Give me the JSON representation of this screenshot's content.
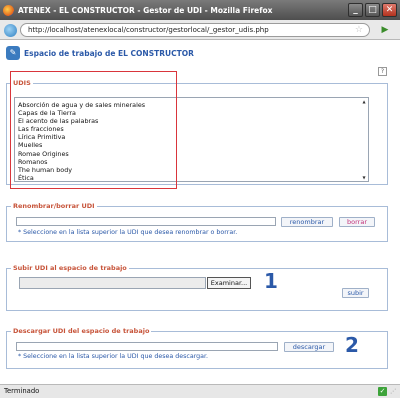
{
  "window": {
    "title": "ATENEX - EL CONSTRUCTOR - Gestor de UDI - Mozilla Firefox",
    "minimize": "_",
    "maximize": "□",
    "close": "✕"
  },
  "browser": {
    "url": "http://localhost/atenexlocal/constructor/gestorlocal/_gestor_udis.php",
    "status": "Terminado"
  },
  "page": {
    "title": "Espacio de trabajo de EL CONSTRUCTOR",
    "help": "?"
  },
  "udis": {
    "legend": "UDIS",
    "items": [
      "Absorción de agua y de sales minerales",
      "Capas de la Tierra",
      "El acento de las palabras",
      "Las fracciones",
      "Lírica Primitiva",
      "Muelles",
      "Romae Origines",
      "Romanos",
      "The human body",
      "Ética"
    ]
  },
  "rename": {
    "legend": "Renombrar/borrar UDI",
    "input_value": "",
    "rename_label": "renombrar",
    "delete_label": "borrar",
    "hint": "* Seleccione en la lista superior la UDI que desea renombrar o borrar."
  },
  "upload": {
    "legend": "Subir UDI al espacio de trabajo",
    "browse_label": "Examinar...",
    "submit_label": "subir",
    "annotation": "1"
  },
  "download": {
    "legend": "Descargar UDI del espacio de trabajo",
    "input_value": "",
    "download_label": "descargar",
    "hint": "* Seleccione en la lista superior la UDI que desea descargar.",
    "annotation": "2"
  },
  "colors": {
    "accent": "#2b59a8",
    "legend": "#c7543a",
    "highlight": "#d9353b",
    "status_ok": "#3da33a"
  }
}
